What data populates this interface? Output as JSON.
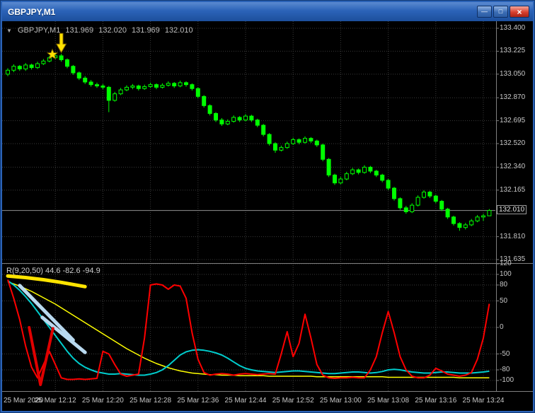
{
  "window": {
    "title": "GBPJPY,M1",
    "minimize_glyph": "—",
    "restore_glyph": "□",
    "close_glyph": "×"
  },
  "ohlc_bar": {
    "dropdown_glyph": "▼",
    "symbol": "GBPJPY,M1",
    "open": "131.969",
    "high": "132.020",
    "low": "131.969",
    "close": "132.010"
  },
  "indicator_label": "R(9,20,50) 44.6 -82.6 -94.9",
  "price_axis": {
    "ticks": [
      [
        "133.400",
        133.4
      ],
      [
        "133.225",
        133.225
      ],
      [
        "133.050",
        133.05
      ],
      [
        "132.870",
        132.87
      ],
      [
        "132.695",
        132.695
      ],
      [
        "132.520",
        132.52
      ],
      [
        "132.340",
        132.34
      ],
      [
        "132.165",
        132.165
      ],
      [
        "131.810",
        131.81
      ],
      [
        "131.635",
        131.635
      ]
    ],
    "current_label": "132.010",
    "current_price": 132.01
  },
  "indicator_axis": {
    "ticks": [
      [
        "120",
        120
      ],
      [
        "100",
        100
      ],
      [
        "80",
        80
      ],
      [
        "50",
        50
      ],
      [
        "0",
        0
      ],
      [
        "-50",
        -50
      ],
      [
        "-80",
        -80
      ],
      [
        "-100",
        -100
      ]
    ]
  },
  "time_axis": {
    "labels": [
      [
        "25 Mar 2020",
        0,
        true
      ],
      [
        "25 Mar 12:12",
        8
      ],
      [
        "25 Mar 12:20",
        16
      ],
      [
        "25 Mar 12:28",
        24
      ],
      [
        "25 Mar 12:36",
        32
      ],
      [
        "25 Mar 12:44",
        40
      ],
      [
        "25 Mar 12:52",
        48
      ],
      [
        "25 Mar 13:00",
        56
      ],
      [
        "25 Mar 13:08",
        64
      ],
      [
        "25 Mar 13:16",
        72
      ],
      [
        "25 Mar 13:24",
        80
      ]
    ]
  },
  "chart_data": {
    "type": "candlestick",
    "symbol": "GBPJPY",
    "timeframe": "M1",
    "price_range": [
      131.635,
      133.4
    ],
    "candles": [
      [
        133.05,
        133.095,
        133.035,
        133.08
      ],
      [
        133.08,
        133.125,
        133.065,
        133.11
      ],
      [
        133.11,
        133.12,
        133.075,
        133.09
      ],
      [
        133.09,
        133.135,
        133.075,
        133.12
      ],
      [
        133.12,
        133.13,
        133.085,
        133.1
      ],
      [
        133.1,
        133.145,
        133.09,
        133.13
      ],
      [
        133.13,
        133.165,
        133.12,
        133.15
      ],
      [
        133.15,
        133.19,
        133.14,
        133.175
      ],
      [
        133.175,
        133.215,
        133.165,
        133.19
      ],
      [
        133.19,
        133.205,
        133.145,
        133.16
      ],
      [
        133.16,
        133.17,
        133.095,
        133.11
      ],
      [
        133.11,
        133.12,
        133.045,
        133.06
      ],
      [
        133.06,
        133.07,
        133.005,
        133.02
      ],
      [
        133.02,
        133.035,
        132.975,
        132.99
      ],
      [
        132.99,
        133.005,
        132.955,
        132.97
      ],
      [
        132.97,
        132.985,
        132.945,
        132.96
      ],
      [
        132.96,
        132.975,
        132.935,
        132.95
      ],
      [
        132.95,
        132.96,
        132.76,
        132.85
      ],
      [
        132.85,
        132.915,
        132.84,
        132.9
      ],
      [
        132.9,
        132.945,
        132.89,
        132.93
      ],
      [
        132.93,
        132.965,
        132.92,
        132.95
      ],
      [
        132.95,
        132.975,
        132.935,
        132.96
      ],
      [
        132.96,
        132.97,
        132.925,
        132.94
      ],
      [
        132.94,
        132.97,
        132.93,
        132.955
      ],
      [
        132.955,
        132.985,
        132.945,
        132.97
      ],
      [
        132.97,
        132.98,
        132.935,
        132.95
      ],
      [
        132.95,
        132.98,
        132.94,
        132.965
      ],
      [
        132.965,
        132.995,
        132.955,
        132.98
      ],
      [
        132.98,
        132.99,
        132.945,
        132.96
      ],
      [
        132.96,
        133.0,
        132.95,
        132.985
      ],
      [
        132.985,
        132.995,
        132.955,
        132.97
      ],
      [
        132.97,
        132.98,
        132.925,
        132.94
      ],
      [
        132.94,
        132.95,
        132.865,
        132.88
      ],
      [
        132.88,
        132.89,
        132.795,
        132.81
      ],
      [
        132.81,
        132.82,
        132.735,
        132.75
      ],
      [
        132.75,
        132.76,
        132.685,
        132.7
      ],
      [
        132.7,
        132.715,
        132.655,
        132.67
      ],
      [
        132.67,
        132.705,
        132.66,
        132.69
      ],
      [
        132.69,
        132.735,
        132.68,
        132.72
      ],
      [
        132.72,
        132.73,
        132.685,
        132.7
      ],
      [
        132.7,
        132.745,
        132.69,
        132.73
      ],
      [
        132.73,
        132.74,
        132.685,
        132.7
      ],
      [
        132.7,
        132.71,
        132.645,
        132.66
      ],
      [
        132.66,
        132.67,
        132.575,
        132.59
      ],
      [
        132.59,
        132.6,
        132.505,
        132.52
      ],
      [
        132.52,
        132.53,
        132.45,
        132.47
      ],
      [
        132.47,
        132.505,
        132.46,
        132.49
      ],
      [
        132.49,
        132.535,
        132.48,
        132.52
      ],
      [
        132.52,
        132.565,
        132.51,
        132.55
      ],
      [
        132.55,
        132.56,
        132.515,
        132.53
      ],
      [
        132.53,
        132.575,
        132.52,
        132.56
      ],
      [
        132.56,
        132.57,
        132.525,
        132.54
      ],
      [
        132.54,
        132.55,
        132.495,
        132.51
      ],
      [
        132.51,
        132.52,
        132.385,
        132.4
      ],
      [
        132.4,
        132.41,
        132.265,
        132.28
      ],
      [
        132.28,
        132.29,
        132.205,
        132.22
      ],
      [
        132.22,
        132.265,
        132.21,
        132.25
      ],
      [
        132.25,
        132.305,
        132.24,
        132.29
      ],
      [
        132.29,
        132.335,
        132.28,
        132.32
      ],
      [
        132.32,
        132.33,
        132.285,
        132.3
      ],
      [
        132.3,
        132.355,
        132.29,
        132.34
      ],
      [
        132.34,
        132.35,
        132.295,
        132.31
      ],
      [
        132.31,
        132.32,
        132.265,
        132.28
      ],
      [
        132.28,
        132.29,
        132.225,
        132.24
      ],
      [
        132.24,
        132.25,
        132.165,
        132.18
      ],
      [
        132.18,
        132.19,
        132.085,
        132.1
      ],
      [
        132.1,
        132.11,
        132.015,
        132.03
      ],
      [
        132.03,
        132.045,
        131.985,
        132.0
      ],
      [
        132.0,
        132.065,
        131.99,
        132.05
      ],
      [
        132.05,
        132.125,
        132.04,
        132.11
      ],
      [
        132.11,
        132.165,
        132.1,
        132.15
      ],
      [
        132.15,
        132.16,
        132.105,
        132.12
      ],
      [
        132.12,
        132.13,
        132.065,
        132.08
      ],
      [
        132.08,
        132.09,
        132.005,
        132.02
      ],
      [
        132.02,
        132.03,
        131.945,
        131.96
      ],
      [
        131.96,
        131.97,
        131.895,
        131.91
      ],
      [
        131.91,
        131.92,
        131.855,
        131.88
      ],
      [
        131.88,
        131.915,
        131.865,
        131.9
      ],
      [
        131.9,
        131.945,
        131.89,
        131.93
      ],
      [
        131.93,
        131.975,
        131.92,
        131.96
      ],
      [
        131.96,
        131.985,
        131.93,
        131.969
      ],
      [
        131.969,
        132.02,
        131.969,
        132.01
      ]
    ],
    "indicator": {
      "name": "R",
      "range": [
        -120,
        120
      ],
      "series": [
        {
          "name": "fast",
          "color": "#FF0000",
          "width": 2,
          "values": [
            90,
            55,
            15,
            -35,
            -75,
            -95,
            -70,
            -45,
            -70,
            -95,
            -98,
            -98,
            -97,
            -98,
            -97,
            -96,
            -45,
            -50,
            -70,
            -88,
            -92,
            -90,
            -88,
            -20,
            80,
            82,
            80,
            72,
            80,
            78,
            55,
            -10,
            -60,
            -85,
            -90,
            -88,
            -87,
            -88,
            -90,
            -88,
            -87,
            -88,
            -89,
            -88,
            -87,
            -88,
            -50,
            -8,
            -55,
            -30,
            25,
            -20,
            -70,
            -90,
            -95,
            -96,
            -95,
            -95,
            -94,
            -95,
            -95,
            -80,
            -55,
            -10,
            30,
            -10,
            -55,
            -80,
            -92,
            -95,
            -95,
            -90,
            -77,
            -82,
            -88,
            -90,
            -92,
            -90,
            -85,
            -60,
            -20,
            44.6
          ]
        },
        {
          "name": "medium",
          "color": "#00CCCC",
          "width": 2,
          "values": [
            88,
            80,
            70,
            58,
            45,
            30,
            15,
            0,
            -15,
            -30,
            -45,
            -58,
            -68,
            -75,
            -80,
            -84,
            -86,
            -88,
            -88,
            -87,
            -88,
            -89,
            -90,
            -90,
            -88,
            -85,
            -80,
            -72,
            -62,
            -52,
            -46,
            -43,
            -42,
            -43,
            -45,
            -48,
            -52,
            -58,
            -65,
            -72,
            -77,
            -80,
            -82,
            -83,
            -84,
            -85,
            -84,
            -83,
            -82,
            -82,
            -83,
            -84,
            -85,
            -86,
            -87,
            -87,
            -86,
            -85,
            -84,
            -84,
            -85,
            -86,
            -85,
            -83,
            -80,
            -79,
            -80,
            -82,
            -84,
            -85,
            -86,
            -86,
            -85,
            -84,
            -84,
            -85,
            -86,
            -86,
            -86,
            -85,
            -84,
            -82.6
          ]
        },
        {
          "name": "slow",
          "color": "#FFFF00",
          "width": 1.5,
          "values": [
            86,
            82,
            78,
            73,
            68,
            62,
            56,
            50,
            44,
            37,
            30,
            23,
            16,
            9,
            2,
            -5,
            -12,
            -19,
            -26,
            -33,
            -40,
            -46,
            -52,
            -58,
            -63,
            -68,
            -72,
            -76,
            -79,
            -82,
            -84,
            -86,
            -87,
            -88,
            -89,
            -89,
            -90,
            -90,
            -90,
            -91,
            -91,
            -91,
            -91,
            -91,
            -92,
            -92,
            -92,
            -92,
            -92,
            -92,
            -92,
            -92,
            -93,
            -93,
            -93,
            -93,
            -93,
            -93,
            -93,
            -93,
            -93,
            -93,
            -93,
            -93,
            -94,
            -94,
            -94,
            -94,
            -94,
            -94,
            -94,
            -94,
            -94,
            -94,
            -94,
            -94,
            -95,
            -95,
            -95,
            -95,
            -95,
            -94.9
          ]
        }
      ]
    },
    "objects": {
      "yellow_band": {
        "color": "#FFE400",
        "width": 5,
        "points": [
          [
            0,
            97
          ],
          [
            3,
            94
          ],
          [
            6,
            90
          ],
          [
            9,
            85
          ],
          [
            11,
            81
          ],
          [
            13,
            77
          ]
        ]
      },
      "blue_trend_1": {
        "color": "#B9D9EF",
        "width": 5,
        "points": [
          [
            2,
            79
          ],
          [
            11,
            -24
          ]
        ]
      },
      "blue_trend_2": {
        "color": "#B9D9EF",
        "width": 5,
        "points": [
          [
            5.8,
            19
          ],
          [
            13,
            -47
          ]
        ]
      },
      "red_zigzag": {
        "color": "#E00000",
        "width": 4,
        "points": [
          [
            3.6,
            0
          ],
          [
            5.5,
            -108
          ],
          [
            7.6,
            -2
          ]
        ]
      }
    },
    "signals": {
      "sell_arrow": {
        "index": 9,
        "price": 133.215
      },
      "star": {
        "index": 7.5,
        "price": 133.2
      }
    }
  },
  "colors": {
    "background": "#000000",
    "grid": "#3a3a3a",
    "candle": "#00FF00",
    "axis_text": "#C8C8C8",
    "separator": "#7f7f7f",
    "current_price_line": "#909090",
    "arrow": "#FFE100",
    "star": "#FFE100"
  }
}
